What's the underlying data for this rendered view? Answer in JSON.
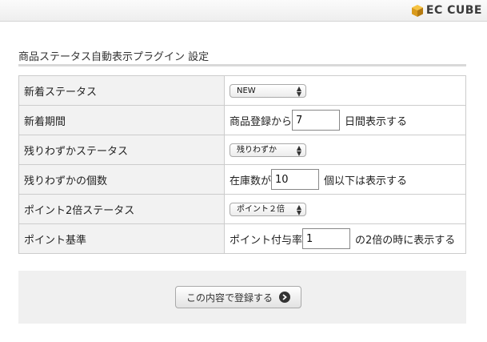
{
  "header": {
    "logo_text": "EC CUBE"
  },
  "page": {
    "title": "商品ステータス自動表示プラグイン 設定"
  },
  "rows": [
    {
      "label": "新着ステータス",
      "select": "NEW"
    },
    {
      "label": "新着期間",
      "prefix": "商品登録から",
      "value": "7",
      "suffix": "日間表示する"
    },
    {
      "label": "残りわずかステータス",
      "select": "残りわずか"
    },
    {
      "label": "残りわずかの個数",
      "prefix": "在庫数が",
      "value": "10",
      "suffix": "個以下は表示する"
    },
    {
      "label": "ポイント2倍ステータス",
      "select": "ポイント２倍"
    },
    {
      "label": "ポイント基準",
      "prefix": "ポイント付与率",
      "value": "1",
      "suffix": "の2倍の時に表示する"
    }
  ],
  "submit": {
    "label": "この内容で登録する"
  }
}
